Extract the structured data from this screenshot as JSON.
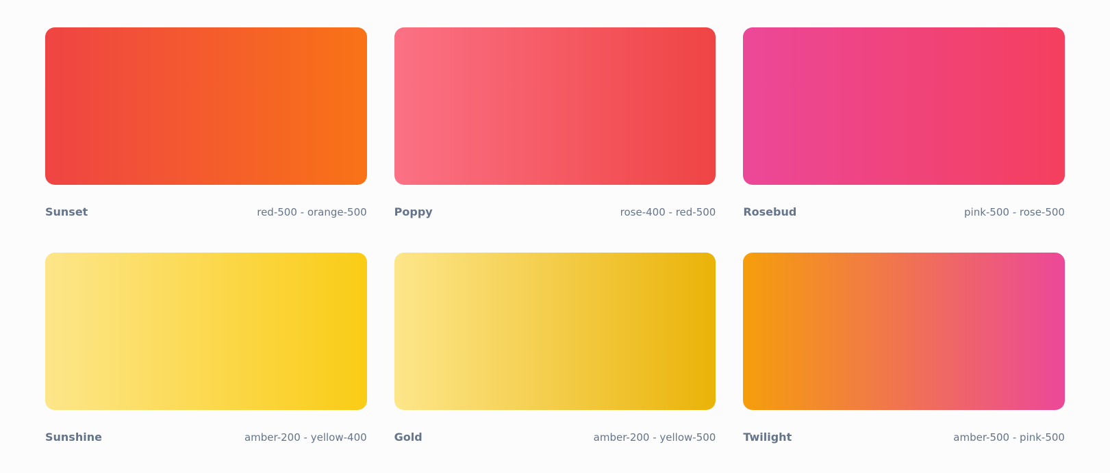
{
  "gradients": [
    {
      "name": "Sunset",
      "colors_label": "red-500 - orange-500",
      "from": "#ef4444",
      "to": "#f97316"
    },
    {
      "name": "Poppy",
      "colors_label": "rose-400 - red-500",
      "from": "#fb7185",
      "to": "#ef4444"
    },
    {
      "name": "Rosebud",
      "colors_label": "pink-500 - rose-500",
      "from": "#ec4899",
      "to": "#f43f5e"
    },
    {
      "name": "Sunshine",
      "colors_label": "amber-200 - yellow-400",
      "from": "#fde68a",
      "to": "#facc15"
    },
    {
      "name": "Gold",
      "colors_label": "amber-200 - yellow-500",
      "from": "#fde68a",
      "to": "#eab308"
    },
    {
      "name": "Twilight",
      "colors_label": "amber-500 - pink-500",
      "from": "#f59e0b",
      "to": "#ec4899"
    }
  ]
}
